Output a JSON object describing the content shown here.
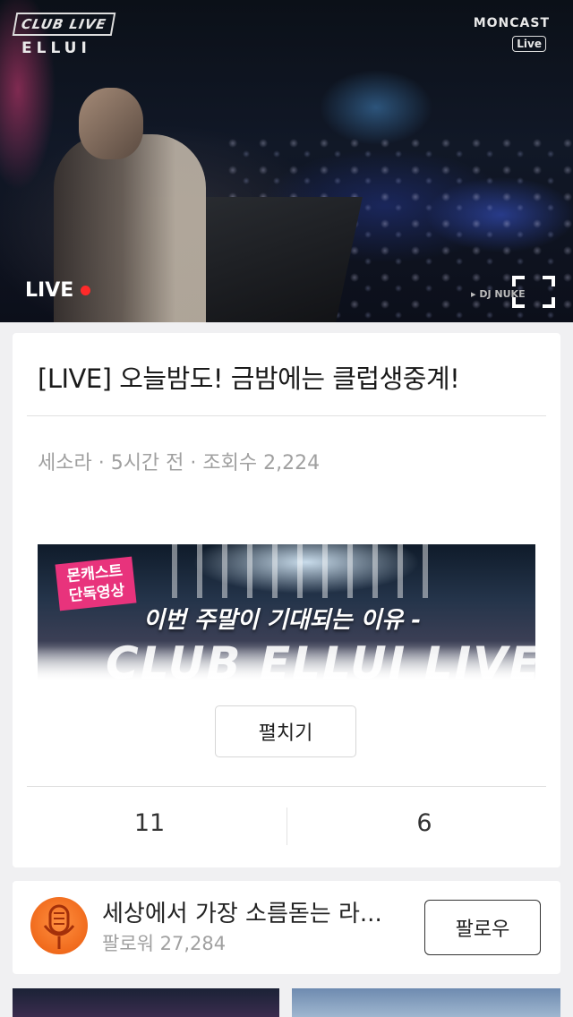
{
  "player": {
    "logo_left": "CLUB LIVE",
    "logo_left_sub": "ELLUI",
    "logo_right": "MONCAST",
    "logo_right_tag": "Live",
    "live_label": "LIVE",
    "dj_credit": "▸ DJ NUKE",
    "colors": {
      "live_dot": "#ff2a2a"
    }
  },
  "post": {
    "title": "[LIVE] 오늘밤도! 금밤에는 클럽생중계!",
    "meta": "세소라 · 5시간 전 · 조회수 2,224",
    "thumbnail": {
      "tag": "몬캐스트 단독영상",
      "headline": "이번 주말이 기대되는 이유 -",
      "club_text": "CLUB ELLUI LIVE"
    },
    "expand_label": "펼치기",
    "stats": {
      "likes": "11",
      "comments": "6"
    }
  },
  "channel": {
    "name": "세상에서 가장 소름돋는 라...",
    "followers": "팔로워 27,284",
    "follow_label": "팔로우",
    "colors": {
      "avatar": "#f06a1c"
    }
  }
}
